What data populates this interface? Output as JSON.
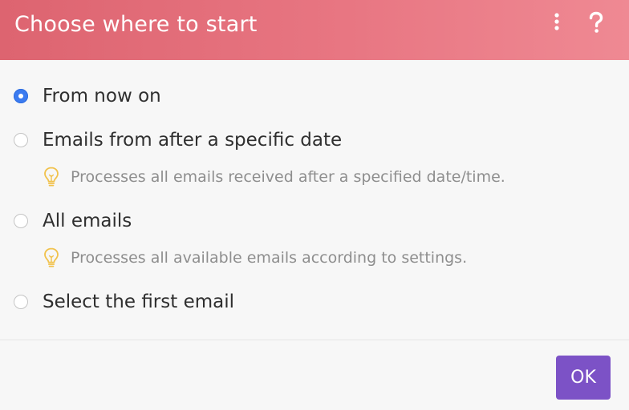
{
  "dialog": {
    "title": "Choose where to start",
    "menu_icon": "kebab-menu-icon",
    "help_icon": "question-mark-icon"
  },
  "options": [
    {
      "label": "From now on",
      "selected": true
    },
    {
      "label": "Emails from after a specific date",
      "selected": false,
      "hint": "Processes all emails received after a specified date/time."
    },
    {
      "label": "All emails",
      "selected": false,
      "hint": "Processes all available emails according to settings."
    },
    {
      "label": "Select the first email",
      "selected": false
    }
  ],
  "hint_icon": "lightbulb-icon",
  "footer": {
    "ok_label": "OK"
  },
  "colors": {
    "header_start": "#dd6470",
    "header_end": "#ef8993",
    "radio_selected": "#3b7bf0",
    "ok_button": "#7c52c6"
  }
}
